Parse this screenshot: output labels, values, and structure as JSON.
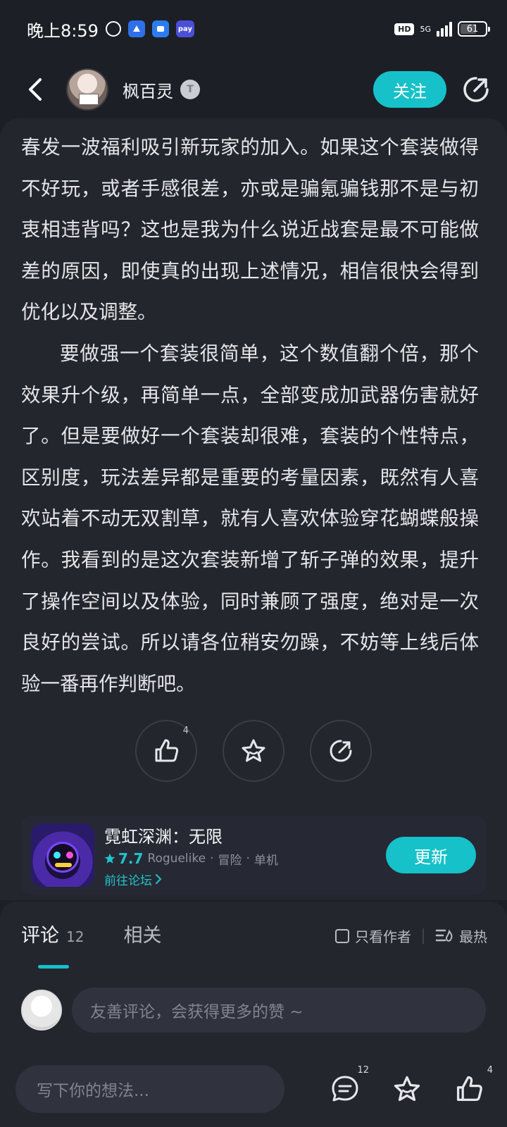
{
  "status_bar": {
    "time": "晚上8:59",
    "pay_label": "pay",
    "hd_label": "HD",
    "network": "5G",
    "battery": "61"
  },
  "header": {
    "author_name": "枫百灵",
    "level_badge": "T",
    "follow_label": "关注"
  },
  "article": {
    "paragraphs": [
      "春发一波福利吸引新玩家的加入。如果这个套装做得不好玩，或者手感很差，亦或是骗氪骗钱那不是与初衷相违背吗？这也是我为什么说近战套是最不可能做差的原因，即使真的出现上述情况，相信很快会得到优化以及调整。",
      "要做强一个套装很简单，这个数值翻个倍，那个效果升个级，再简单一点，全部变成加武器伤害就好了。但是要做好一个套装却很难，套装的个性特点，区别度，玩法差异都是重要的考量因素，既然有人喜欢站着不动无双割草，就有人喜欢体验穿花蝴蝶般操作。我看到的是这次套装新增了斩子弹的效果，提升了操作空间以及体验，同时兼顾了强度，绝对是一次良好的尝试。所以请各位稍安勿躁，不妨等上线后体验一番再作判断吧。"
    ]
  },
  "actions": {
    "like_count": "4"
  },
  "game_card": {
    "title": "霓虹深渊：无限",
    "rating": "7.7",
    "tag1": "Roguelike",
    "tag2": "冒险",
    "tag3": "单机",
    "forum_link": "前往论坛",
    "update_label": "更新",
    "separator": "·"
  },
  "comments": {
    "tab_comments": "评论",
    "comment_count": "12",
    "tab_related": "相关",
    "filter_author_only": "只看作者",
    "sort_hot": "最热",
    "input_placeholder": "友善评论，会获得更多的赞 ~"
  },
  "bottom_bar": {
    "thought_placeholder": "写下你的想法...",
    "comment_count": "12",
    "like_count": "4"
  },
  "colors": {
    "accent": "#16c1c9",
    "background": "#1d1f26",
    "card": "#24262e"
  }
}
